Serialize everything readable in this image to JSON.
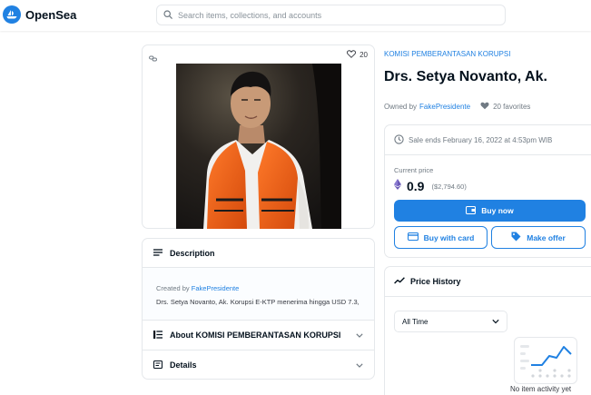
{
  "header": {
    "brand": "OpenSea",
    "search_placeholder": "Search items, collections, and accounts"
  },
  "media": {
    "favorites_count": "20"
  },
  "description": {
    "heading": "Description",
    "created_by_label": "Created by",
    "creator": "FakePresidente",
    "text": "Drs. Setya Novanto, Ak. Korupsi E-KTP menerima hingga USD 7.3,"
  },
  "accordions": {
    "about_label": "About KOMISI PEMBERANTASAN KORUPSI",
    "details_label": "Details"
  },
  "item": {
    "collection": "KOMISI PEMBERANTASAN KORUPSI",
    "title": "Drs. Setya Novanto, Ak.",
    "owned_by_label": "Owned by",
    "owner": "FakePresidente",
    "favorites_text": "20 favorites"
  },
  "sale": {
    "ends_text": "Sale ends February 16, 2022 at 4:53pm WIB",
    "current_price_label": "Current price",
    "price": "0.9",
    "price_usd": "($2,794.60)",
    "buy_now_label": "Buy now",
    "buy_card_label": "Buy with card",
    "make_offer_label": "Make offer"
  },
  "price_history": {
    "heading": "Price History",
    "range_selected": "All Time",
    "empty_text": "No item activity yet"
  },
  "colors": {
    "accent": "#2081e2",
    "eth_purple": "#6b5ab7",
    "text_primary": "#04111d",
    "text_secondary": "#707a83",
    "border": "#e5e8eb"
  },
  "icons": {
    "logo": "opensea-boat-icon",
    "search": "search-icon",
    "chain": "link-icon",
    "favorite": "heart-icon",
    "clock": "clock-icon",
    "eth": "ethereum-icon",
    "wallet": "wallet-icon",
    "card": "credit-card-icon",
    "tag": "tag-icon",
    "chart": "trend-line-icon",
    "chevron": "chevron-down-icon"
  }
}
